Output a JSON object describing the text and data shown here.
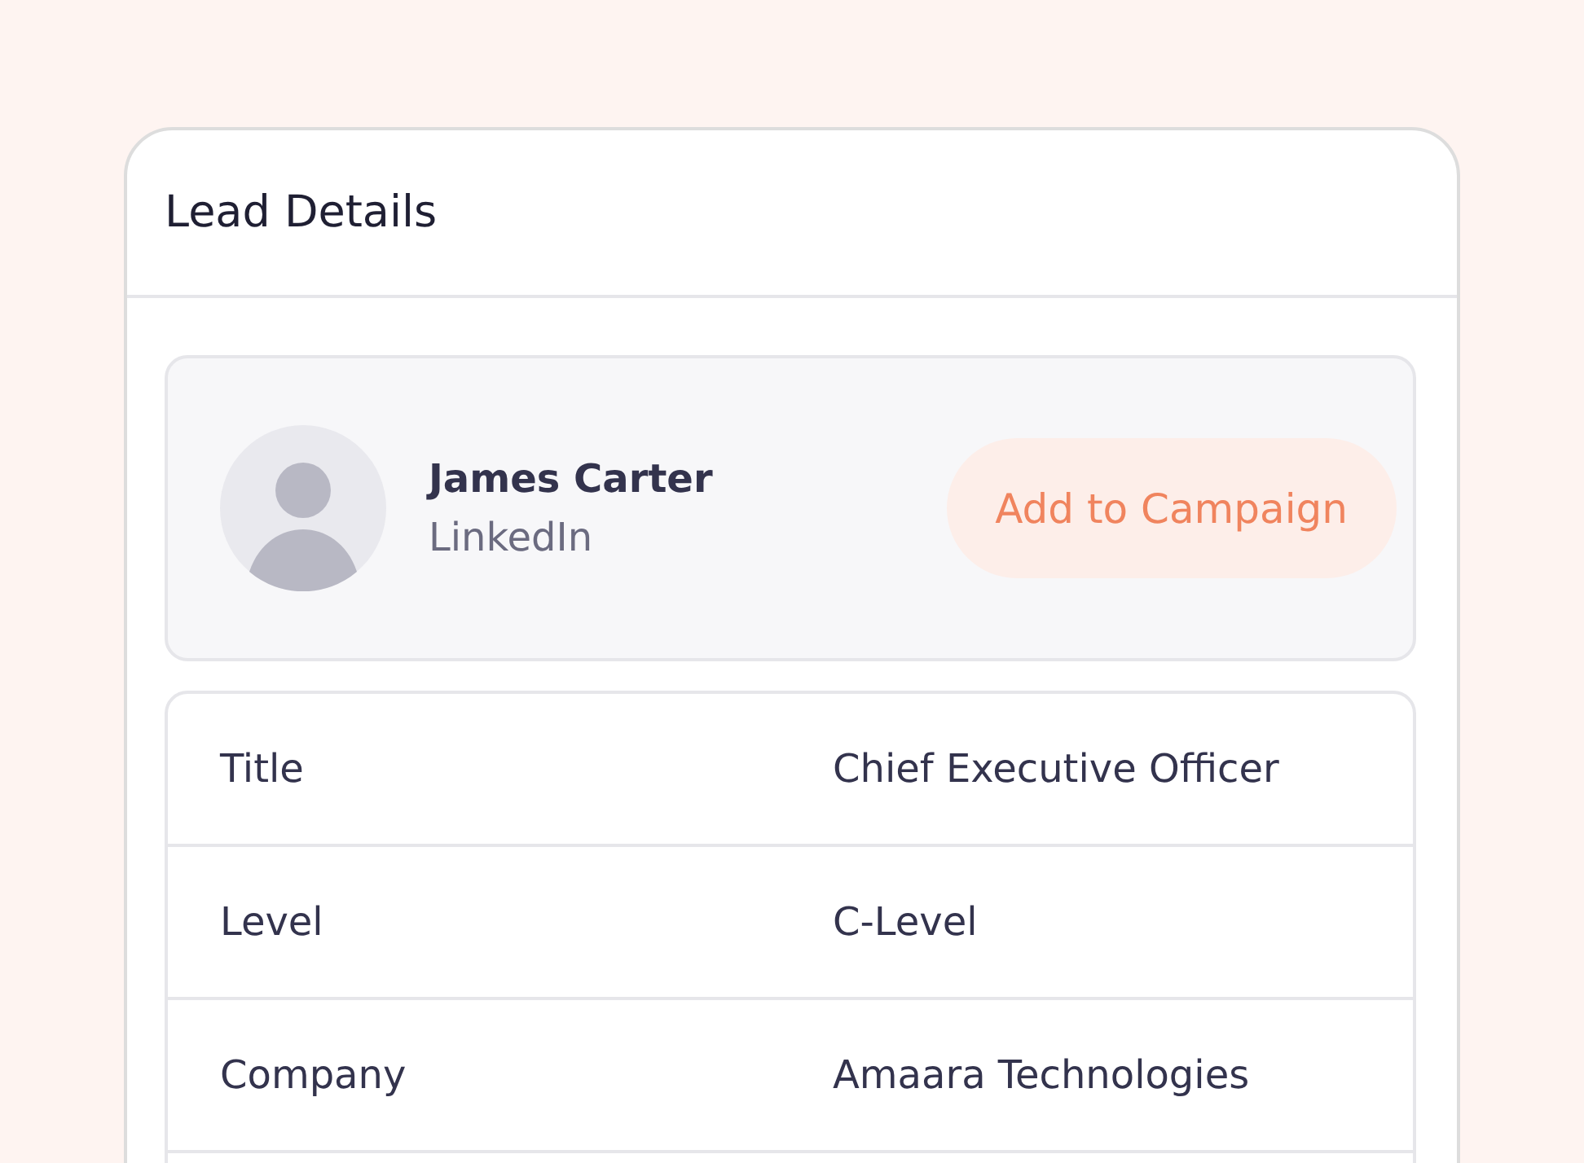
{
  "card": {
    "title": "Lead Details"
  },
  "profile": {
    "name": "James Carter",
    "source": "LinkedIn",
    "action": "Add to Campaign"
  },
  "details": [
    {
      "label": "Title",
      "value": "Chief Executive Officer"
    },
    {
      "label": "Level",
      "value": "C-Level"
    },
    {
      "label": "Company",
      "value": "Amaara Technologies"
    }
  ]
}
